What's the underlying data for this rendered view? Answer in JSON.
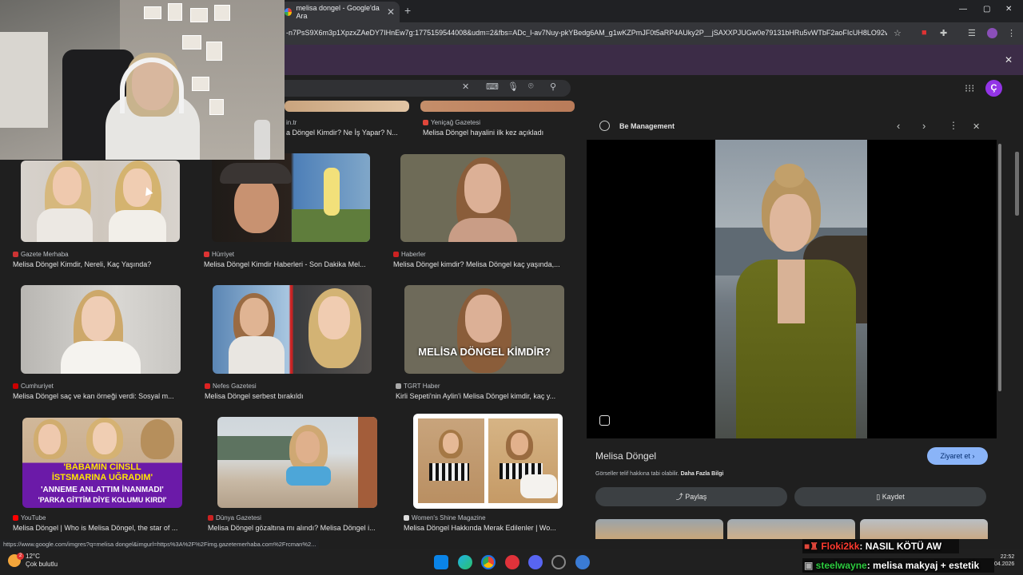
{
  "browser": {
    "tab_title": "melisa dongel - Google'da Ara",
    "new_tab": "+",
    "url": "-n7PsS9X6m3p1XpzxZAeDY7IHnEw7g:1775159544008&udm=2&fbs=ADc_l-av7Nuy-pkYBedg6AM_g1wKZPmJF0t5aRP4AUky2P__jSAXXPJUGw0e79131bHRu5vWTbF2aoFIcUH8LO92v...",
    "minimize": "—",
    "maximize": "▢",
    "close": "✕",
    "tab_close": "✕",
    "infobar_close": "✕"
  },
  "google": {
    "clear": "✕",
    "avatar_letter": "Ç",
    "apps_icon": "⋮⋮⋮"
  },
  "results": [
    {
      "source": "",
      "title": "",
      "partial_source": "in.tr",
      "partial_title": "a Döngel Kimdir? Ne İş Yapar? N..."
    },
    {
      "source": "Yeniçağ Gazetesi",
      "title": "Melisa Döngel hayalini ilk kez açıkladı"
    },
    {
      "source": "Gazete Merhaba",
      "title": "Melisa Döngel Kimdir, Nereli, Kaç Yaşında?"
    },
    {
      "source": "Hürriyet",
      "title": "Melisa Döngel Kimdir Haberleri - Son Dakika Mel..."
    },
    {
      "source": "Haberler",
      "title": "Melisa Döngel kimdir? Melisa Döngel kaç yaşında,..."
    },
    {
      "source": "Cumhuriyet",
      "title": "Melisa Döngel saç ve kan örneği verdi: Sosyal m..."
    },
    {
      "source": "Nefes Gazetesi",
      "title": "Melisa Döngel serbest bırakıldı"
    },
    {
      "source": "TGRT Haber",
      "title": "Kirli Sepeti'nin Aylin'i Melisa Döngel kimdir, kaç y..."
    },
    {
      "source": "YouTube",
      "title": "Melisa Döngel | Who is Melisa Döngel, the star of ..."
    },
    {
      "source": "Dünya Gazetesi",
      "title": "Melisa Döngel gözaltına mı alındı? Melisa Döngel i..."
    },
    {
      "source": "Women's Shine Magazine",
      "title": "Melisa Döngel Hakkında Merak Edilenler | Wo..."
    }
  ],
  "thumb_text": {
    "tgrt_overlay": "MELİSA DÖNGEL KİMDİR?",
    "yt_line1": "'BABAMIN CİNSLL",
    "yt_line2": "İSTSMARINA UĞRADIM'",
    "yt_line3": "'ANNEME ANLATTIM İNANMADI'",
    "yt_line4": "'PARKA GİTTİM DİYE KOLUMU KIRDI'"
  },
  "panel": {
    "site": "Be Management",
    "title": "Melisa Döngel",
    "visit": "Ziyaret et ›",
    "copyright": "Görseller telif hakkına tabi olabilir.",
    "learn_more": "Daha Fazla Bilgi",
    "share": "Paylaş",
    "save": "Kaydet",
    "prev": "‹",
    "next": "›",
    "more": "⋮",
    "close": "✕"
  },
  "status_url": "https://www.google.com/imgres?q=melisa dongel&imgurl=https%3A%2F%2Fimg.gazetemerhaba.com%2Frcman%2...",
  "taskbar": {
    "temp": "12°C",
    "weather": "Çok bulutlu",
    "time": "22:52",
    "date": "04.2026",
    "weather_badge": "2"
  },
  "chat": [
    {
      "user": "Floki2kk",
      "message": ": NASIL KÖTÜ AW",
      "user_color": "#ff3b30"
    },
    {
      "user": "steelwayne",
      "message": ": melisa makyaj + estetik",
      "user_color": "#2ecc40"
    }
  ],
  "colors": {
    "accent": "#8ab4f8",
    "profile": "#9334e6",
    "infobar": "#3c2c47"
  }
}
